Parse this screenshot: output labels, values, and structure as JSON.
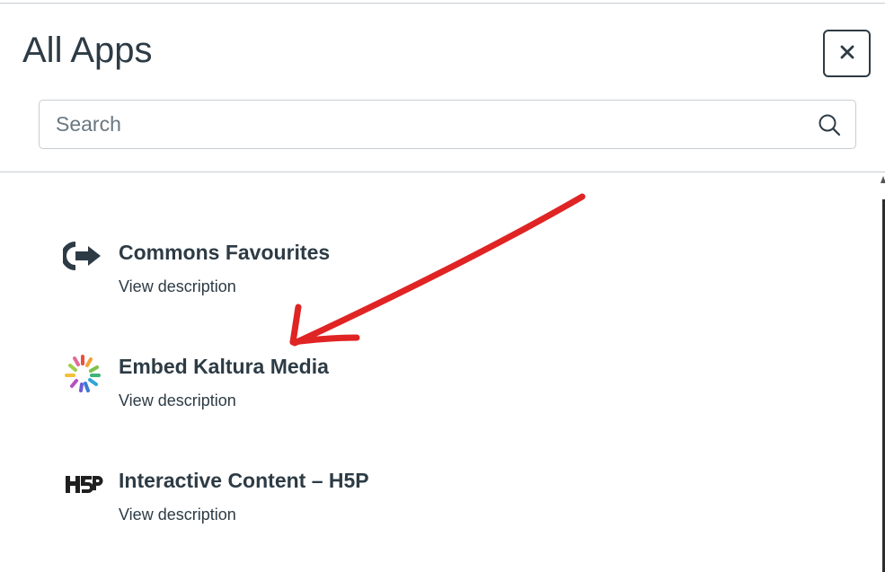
{
  "dialog": {
    "title": "All Apps",
    "close_icon": "close-icon"
  },
  "search": {
    "placeholder": "Search",
    "value": "",
    "icon": "search-icon"
  },
  "apps": [
    {
      "name": "Commons Favourites",
      "description_link": "View description",
      "icon": "commons-icon"
    },
    {
      "name": "Embed Kaltura Media",
      "description_link": "View description",
      "icon": "kaltura-icon"
    },
    {
      "name": "Interactive Content – H5P",
      "description_link": "View description",
      "icon": "h5p-icon"
    }
  ],
  "annotation": {
    "type": "arrow",
    "color": "#e02424",
    "points_to": "Embed Kaltura Media"
  },
  "colors": {
    "text": "#2d3b45",
    "border": "#c7cdd1",
    "annotation": "#e02424"
  }
}
